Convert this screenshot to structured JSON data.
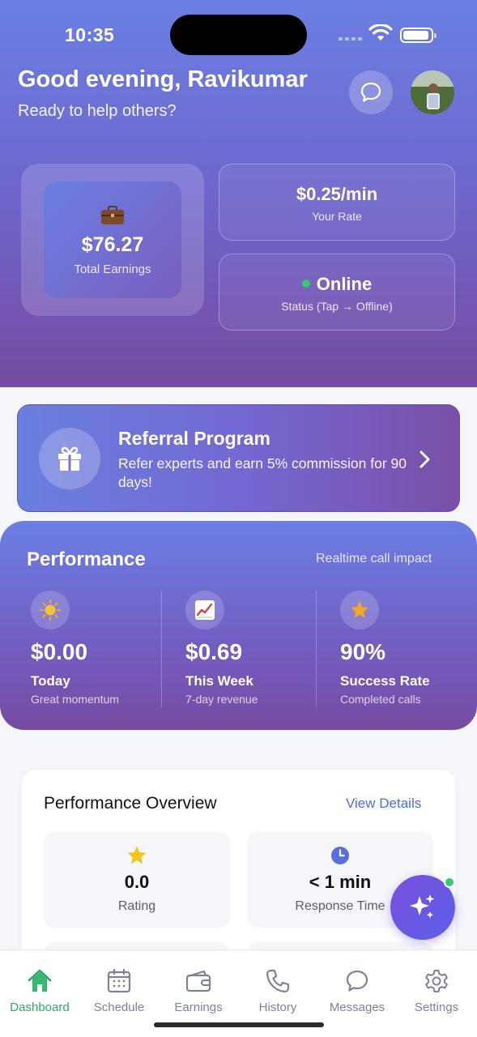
{
  "status_bar": {
    "time": "10:35"
  },
  "header": {
    "greeting": "Good evening, Ravikumar",
    "subtitle": "Ready to help others?"
  },
  "earnings_card": {
    "amount": "$76.27",
    "label": "Total Earnings",
    "icon": "briefcase-icon"
  },
  "rate_card": {
    "value": "$0.25/min",
    "label": "Your Rate"
  },
  "status_card": {
    "value": "Online",
    "label": "Status (Tap → Offline)",
    "dot_color": "#2ecc71"
  },
  "referral": {
    "title": "Referral Program",
    "description": "Refer experts and earn 5% commission for 90 days!",
    "icon": "gift-icon"
  },
  "performance": {
    "title": "Performance",
    "subtitle": "Realtime call impact",
    "stats": [
      {
        "icon": "sun-icon",
        "value": "$0.00",
        "label": "Today",
        "note": "Great momentum"
      },
      {
        "icon": "chart-up-icon",
        "value": "$0.69",
        "label": "This Week",
        "note": "7-day revenue"
      },
      {
        "icon": "star-icon",
        "value": "90%",
        "label": "Success Rate",
        "note": "Completed calls"
      }
    ]
  },
  "overview": {
    "title": "Performance Overview",
    "link": "View Details",
    "tiles": [
      {
        "icon": "star-icon",
        "value": "0.0",
        "label": "Rating"
      },
      {
        "icon": "clock-icon",
        "value": "< 1 min",
        "label": "Response Time"
      }
    ]
  },
  "tabbar": {
    "tabs": [
      {
        "label": "Dashboard",
        "icon": "home-icon",
        "active": true
      },
      {
        "label": "Schedule",
        "icon": "calendar-icon"
      },
      {
        "label": "Earnings",
        "icon": "wallet-icon"
      },
      {
        "label": "History",
        "icon": "phone-icon"
      },
      {
        "label": "Messages",
        "icon": "chat-icon"
      },
      {
        "label": "Settings",
        "icon": "gear-icon"
      }
    ]
  },
  "colors": {
    "accent": "#6b7fe3",
    "accent_dark": "#764ba2",
    "active_tab": "#2fa866",
    "link": "#4a6de0"
  }
}
